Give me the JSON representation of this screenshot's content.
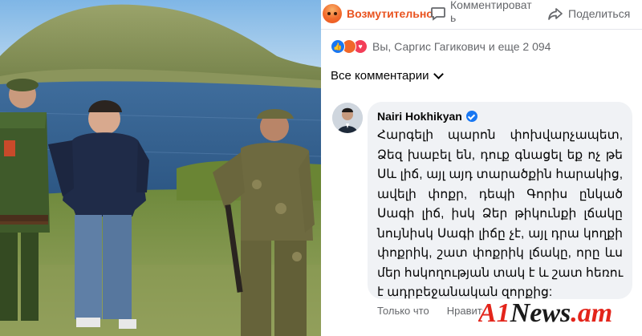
{
  "action_bar": {
    "reaction_label": "Возмутительно",
    "comment_label_line1": "Комментироват",
    "comment_label_line2": "ь",
    "share_label": "Поделиться",
    "reaction_icon": "angry-reaction-icon",
    "comment_icon": "comment-bubble-icon",
    "share_icon": "share-arrow-icon"
  },
  "reactions_summary": {
    "text": "Вы, Саргис Гагикович и еще 2 094",
    "icons": [
      "like-icon",
      "angry-icon",
      "love-icon"
    ]
  },
  "comments_filter": {
    "label": "Все комментарии"
  },
  "comment": {
    "author": "Nairi Hokhikyan",
    "verified": true,
    "lines": [
      "Հարգելի պարոն փոխվարչապետ,",
      "Ձեզ խաբել են, դուք գնացել եք ոչ թե",
      "Սև լիճ, այլ այդ տարածքին հարակից,",
      "ավելի փոքր, դեպի Գորիս ընկած",
      "Սագի լիճ, իսկ Ձեր թիկունքի լճակը",
      "նույնիսկ Սագի լիճը չէ, այլ դրա կողքի",
      "փոքրիկ, շատ փոքրիկ լճակը, որը ևս",
      "մեր հսկողության տակ է և շատ հեռու",
      "է ադրբեջանական զորքից:"
    ],
    "meta_time": "Только что",
    "meta_like": "Нравится"
  },
  "watermark": {
    "text_a1": "A1",
    "text_news": "News",
    "text_dot": ".",
    "text_am": "am",
    "color_red": "#e3251b",
    "color_dark": "#1a1a1a"
  },
  "colors": {
    "accent": "#1877f2",
    "text_secondary": "#65676b",
    "bubble_bg": "#f0f2f5"
  }
}
